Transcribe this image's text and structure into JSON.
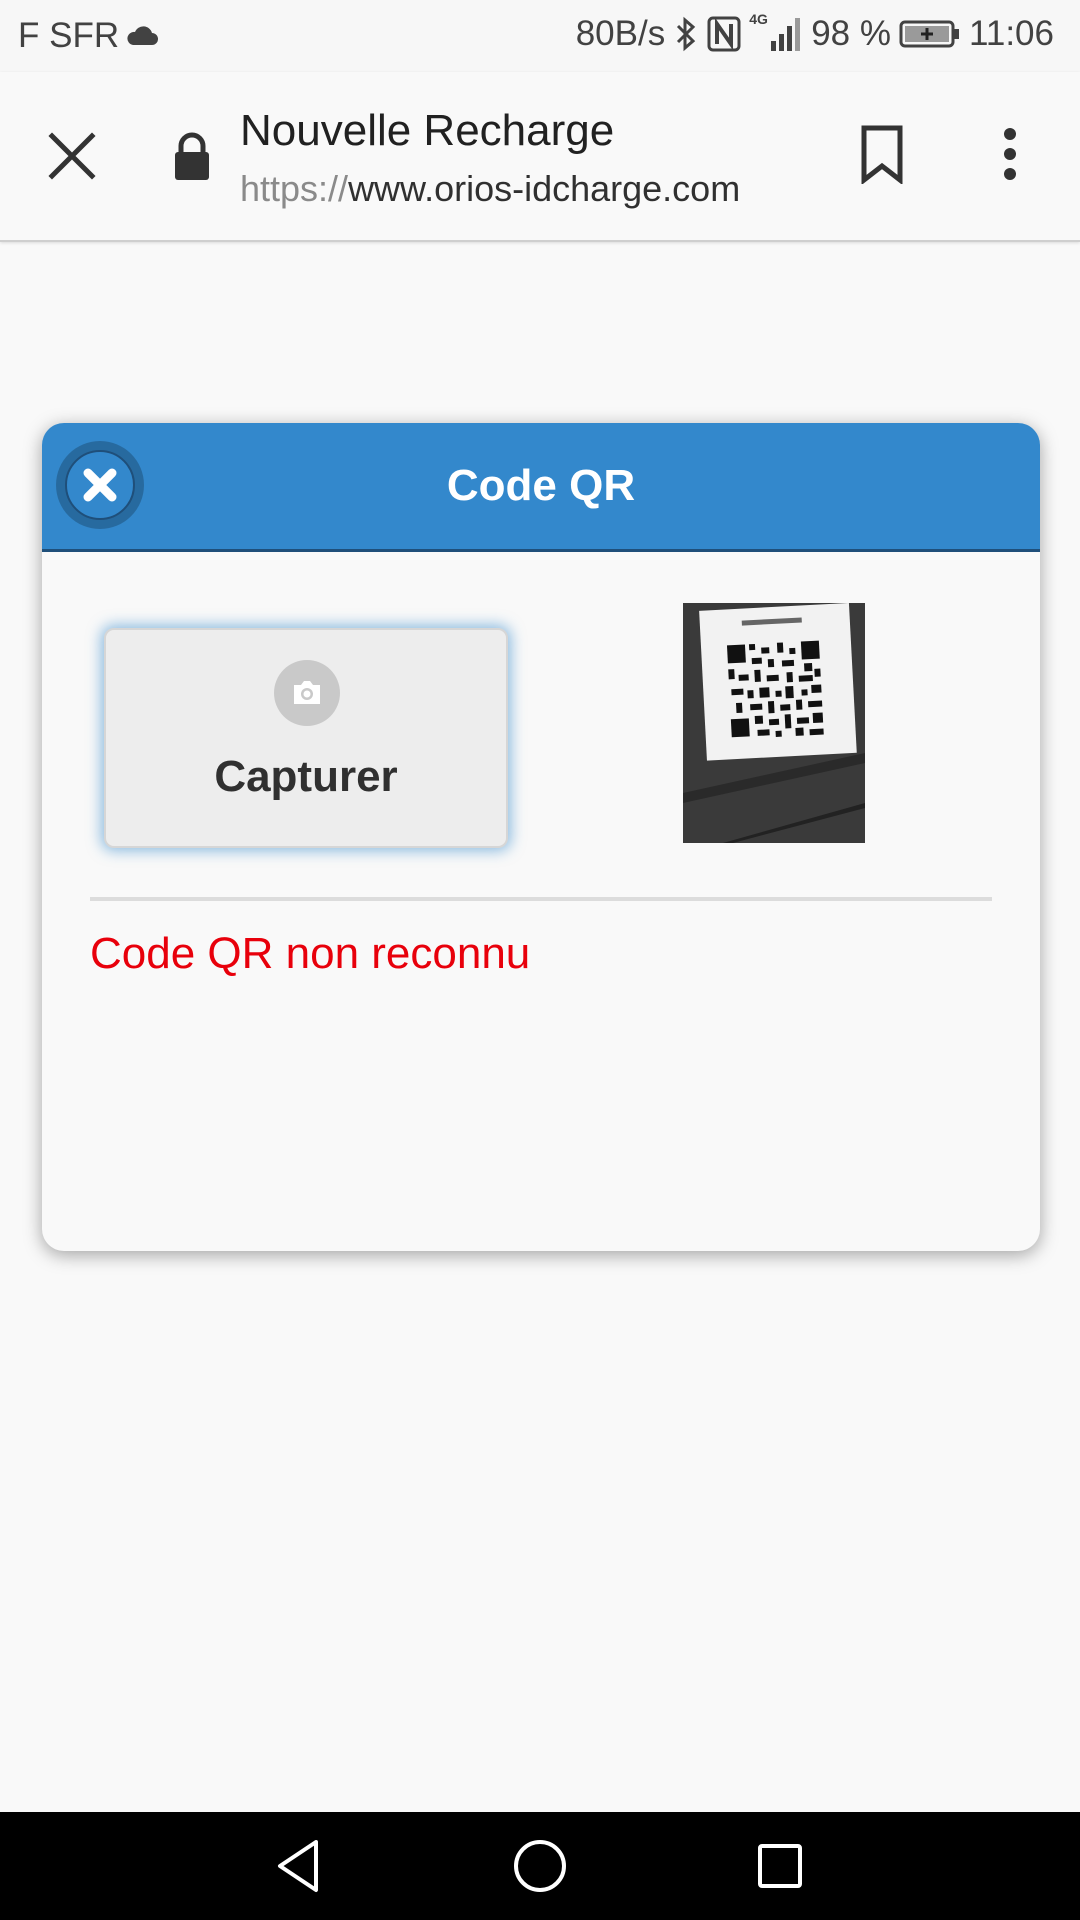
{
  "status_bar": {
    "carrier": "F SFR",
    "speed": "80B/s",
    "network": "4G",
    "battery": "98 %",
    "time": "11:06"
  },
  "toolbar": {
    "title": "Nouvelle Recharge",
    "url_scheme": "https://",
    "url_host": "www.orios-idcharge.com"
  },
  "dialog": {
    "title": "Code QR",
    "capture_label": "Capturer",
    "error_message": "Code QR non reconnu"
  },
  "colors": {
    "header": "#3388cc",
    "error": "#e8000b"
  },
  "icons": {
    "close": "close-icon",
    "lock": "lock-icon",
    "bookmark": "bookmark-icon",
    "menu": "more-vert-icon",
    "dialog_close": "close-circle-icon",
    "camera": "camera-icon",
    "back": "nav-back-icon",
    "home": "nav-home-icon",
    "recents": "nav-recents-icon"
  }
}
